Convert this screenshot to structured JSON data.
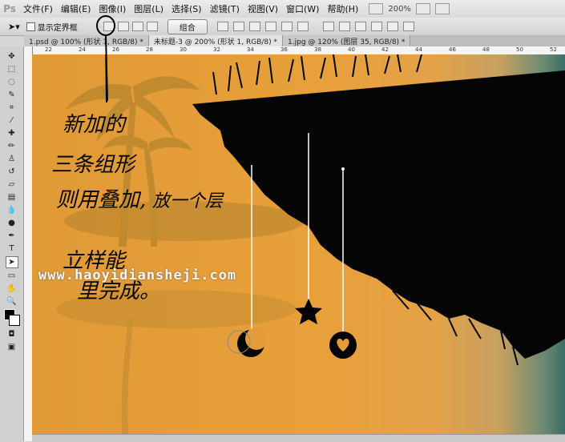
{
  "app": {
    "logo": "Ps"
  },
  "menubar": {
    "items": [
      "文件(F)",
      "编辑(E)",
      "图像(I)",
      "图层(L)",
      "选择(S)",
      "滤镜(T)",
      "视图(V)",
      "窗口(W)",
      "帮助(H)"
    ],
    "zoom": "200%"
  },
  "options": {
    "show_bounds_label": "显示定界框",
    "combine_label": "组合"
  },
  "tabs": [
    {
      "label": "1.psd @ 100% (形状 1, RGB/8) *",
      "active": false
    },
    {
      "label": "未标题-3 @ 200% (形状 1, RGB/8) *",
      "active": true
    },
    {
      "label": "1.jpg @ 120% (图层 35, RGB/8) *",
      "active": false
    }
  ],
  "ruler": {
    "ticks": [
      "22",
      "24",
      "26",
      "28",
      "30",
      "32",
      "34",
      "36",
      "38",
      "40",
      "42",
      "44",
      "46",
      "48",
      "50",
      "52"
    ]
  },
  "annotation": {
    "lines": [
      "新加的",
      "三条组形",
      "则用叠加,",
      "放一个层",
      "立样能",
      "里完成。"
    ]
  },
  "watermark": "www.haoyidiansheji.com",
  "colors": {
    "canvas_orange": "#e39c38",
    "silhouette": "#050505",
    "teal": "#3d6d67"
  }
}
